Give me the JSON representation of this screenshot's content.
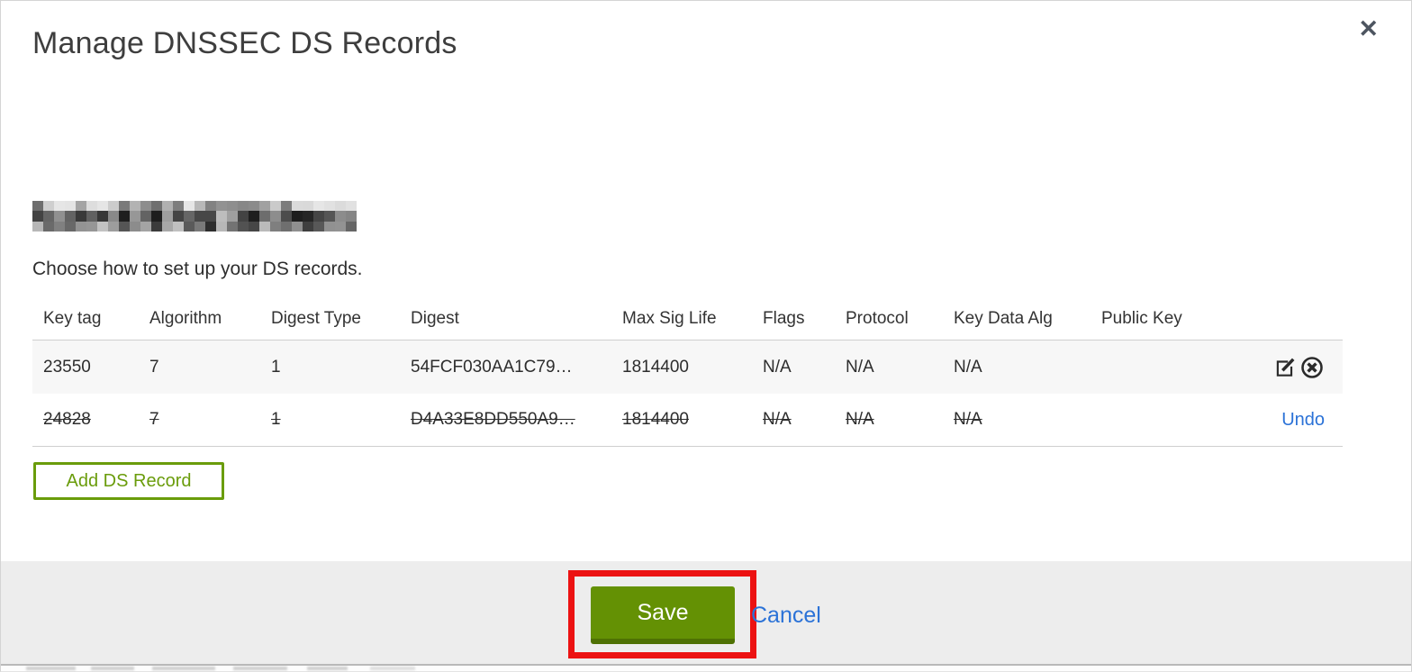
{
  "modal": {
    "title": "Manage DNSSEC DS Records",
    "instruction": "Choose how to set up your DS records."
  },
  "icons": {
    "close": "✕",
    "edit": "edit-pencil-square",
    "delete": "circle-x"
  },
  "table": {
    "columns": [
      "Key tag",
      "Algorithm",
      "Digest Type",
      "Digest",
      "Max Sig Life",
      "Flags",
      "Protocol",
      "Key Data Alg",
      "Public Key"
    ],
    "rows": [
      {
        "key_tag": "23550",
        "algorithm": "7",
        "digest_type": "1",
        "digest": "54FCF030AA1C79…",
        "max_sig_life": "1814400",
        "flags": "N/A",
        "protocol": "N/A",
        "key_data_alg": "N/A",
        "public_key": "",
        "state": "normal"
      },
      {
        "key_tag": "24828",
        "algorithm": "7",
        "digest_type": "1",
        "digest": "D4A33E8DD550A9…",
        "max_sig_life": "1814400",
        "flags": "N/A",
        "protocol": "N/A",
        "key_data_alg": "N/A",
        "public_key": "",
        "state": "deleted",
        "undo_label": "Undo"
      }
    ]
  },
  "buttons": {
    "add_ds_record": "Add DS Record",
    "save": "Save",
    "cancel": "Cancel"
  },
  "colors": {
    "button_green": "#649104",
    "button_green_dark": "#4e7103",
    "outline_green": "#6a9c0b",
    "link_blue": "#2b72d7",
    "annotation_red": "#ec1212",
    "footer_bg": "#ededed",
    "row_alt_bg": "#f7f7f7"
  }
}
